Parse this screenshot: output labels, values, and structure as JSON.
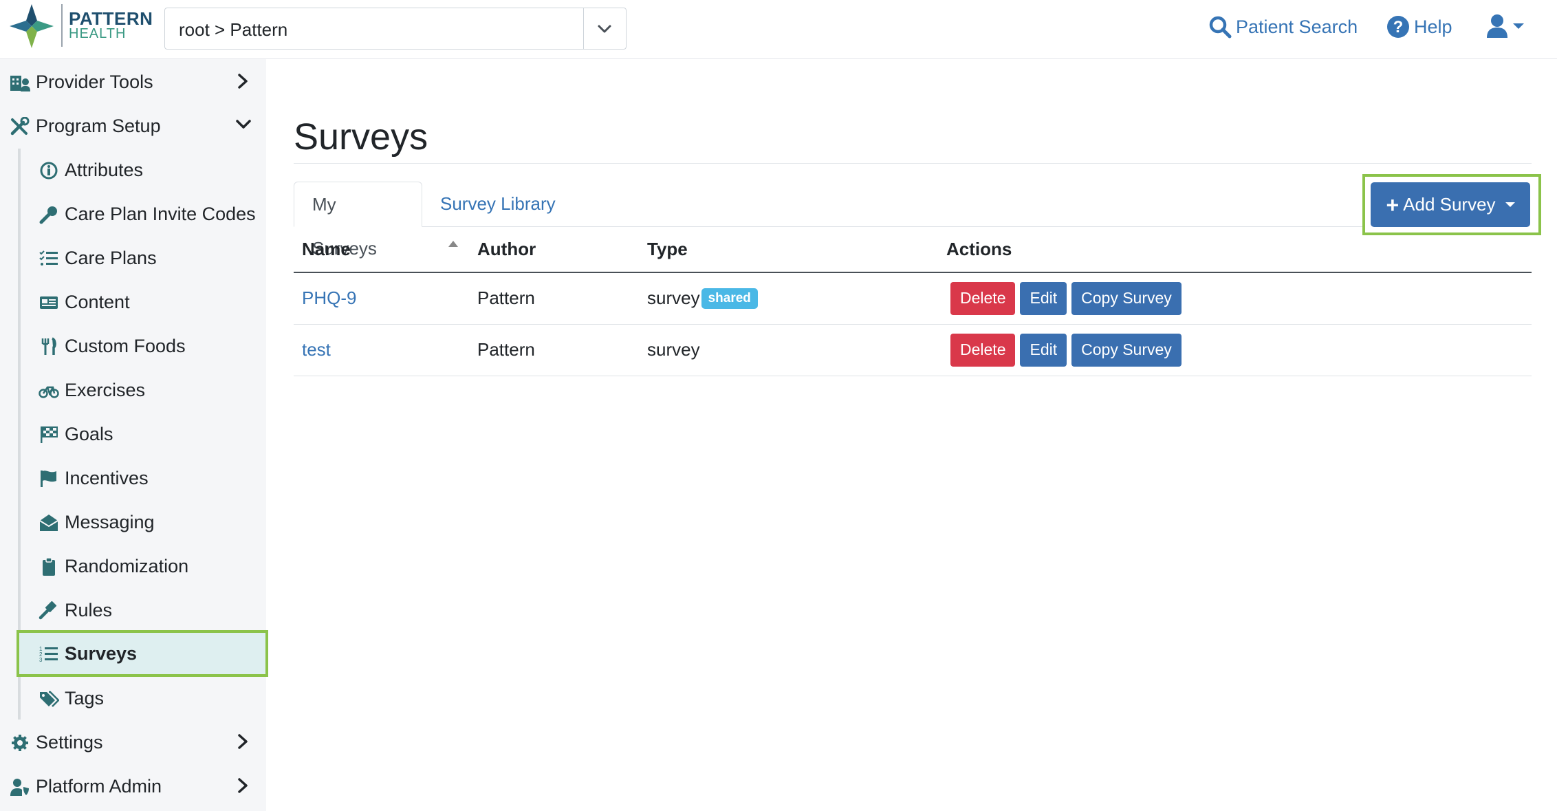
{
  "brand": {
    "line1": "PATTERN",
    "line2": "HEALTH"
  },
  "org_select": {
    "value": "root > Pattern"
  },
  "header": {
    "patient_search": "Patient Search",
    "help": "Help"
  },
  "sidebar": {
    "provider_tools": "Provider Tools",
    "program_setup": "Program Setup",
    "items": [
      {
        "label": "Attributes",
        "icon": "info-circle-icon"
      },
      {
        "label": "Care Plan Invite Codes",
        "icon": "key-icon"
      },
      {
        "label": "Care Plans",
        "icon": "tasks-icon"
      },
      {
        "label": "Content",
        "icon": "newspaper-icon"
      },
      {
        "label": "Custom Foods",
        "icon": "utensils-icon"
      },
      {
        "label": "Exercises",
        "icon": "bicycle-icon"
      },
      {
        "label": "Goals",
        "icon": "checkered-flag-icon"
      },
      {
        "label": "Incentives",
        "icon": "flag-icon"
      },
      {
        "label": "Messaging",
        "icon": "envelope-open-icon"
      },
      {
        "label": "Randomization",
        "icon": "clipboard-icon"
      },
      {
        "label": "Rules",
        "icon": "gavel-icon"
      },
      {
        "label": "Surveys",
        "icon": "list-ol-icon",
        "active": true
      },
      {
        "label": "Tags",
        "icon": "tags-icon"
      }
    ],
    "settings": "Settings",
    "platform_admin": "Platform Admin"
  },
  "main": {
    "title": "Surveys",
    "tabs": [
      {
        "label": "My Surveys",
        "active": true
      },
      {
        "label": "Survey Library",
        "active": false
      }
    ],
    "add_button": "Add Survey",
    "table": {
      "columns": [
        "Name",
        "Author",
        "Type",
        "Actions"
      ],
      "rows": [
        {
          "name": "PHQ-9",
          "author": "Pattern",
          "type": "survey",
          "badge": "shared"
        },
        {
          "name": "test",
          "author": "Pattern",
          "type": "survey",
          "badge": ""
        }
      ],
      "actions": {
        "delete": "Delete",
        "edit": "Edit",
        "copy": "Copy Survey"
      }
    }
  },
  "colors": {
    "accent": "#3674b5",
    "highlight": "#8bc34a",
    "danger": "#d9384a",
    "badge": "#4ab8e6"
  }
}
